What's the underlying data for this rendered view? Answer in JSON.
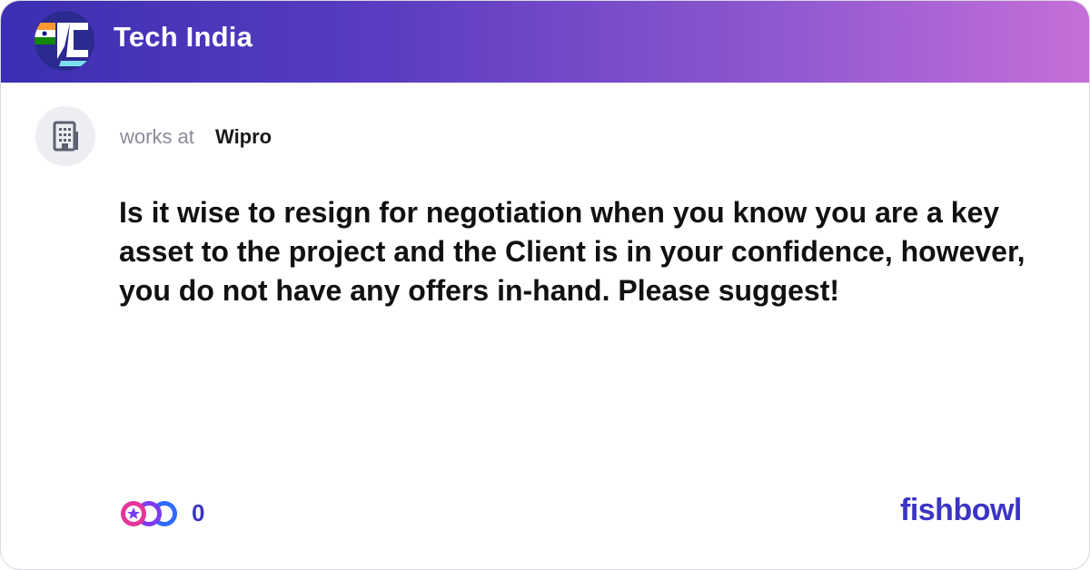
{
  "header": {
    "bowl_name": "Tech India",
    "bowl_logo_icon": "tech-india-flag-logo-icon"
  },
  "author": {
    "avatar_icon": "building-icon",
    "works_at_label": "works at",
    "company": "Wipro"
  },
  "post": {
    "text": "Is it wise to resign for negotiation when you know you are a key asset to the project and the Client is in your confidence, however, you do not have any offers in-hand. Please suggest!"
  },
  "footer": {
    "reactions_icon": "reaction-emoji-stack-icon",
    "reaction_count": "0",
    "brand": "fishbowl"
  },
  "colors": {
    "header_gradient_start": "#3b2fb1",
    "header_gradient_end": "#c56fd8",
    "accent": "#3b35c4"
  }
}
